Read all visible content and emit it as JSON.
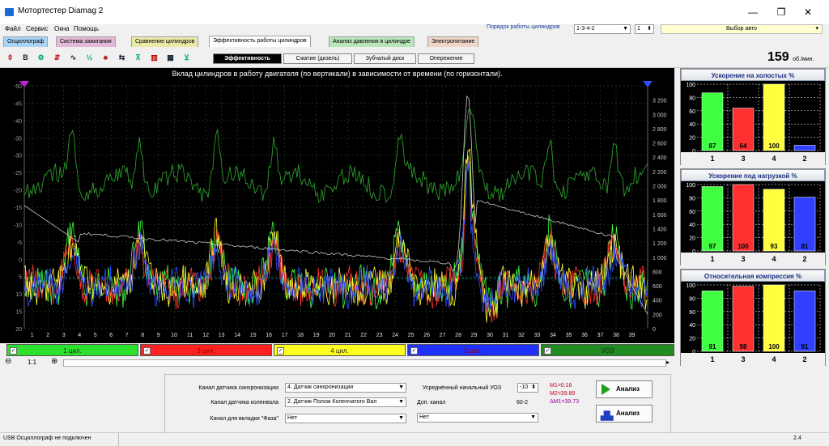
{
  "window": {
    "title": "Мотортестер Diamag 2",
    "minimize": "—",
    "restore": "❐",
    "close": "✕"
  },
  "menu": [
    "Файл",
    "Сервис",
    "Окна",
    "Помощь"
  ],
  "cyl_order": {
    "label": "Порядок работы цилиндров",
    "value": "1-3-4-2",
    "count": "1"
  },
  "vybor": "Выбор авто",
  "tabs": [
    {
      "label": "Осциллограф",
      "color": "#a9d4f5"
    },
    {
      "label": "Система зажигания",
      "color": "#e4b8d8"
    },
    {
      "label": "Сравнение цилиндров",
      "color": "#eaeaa8"
    },
    {
      "label": "Эффективность работы цилиндров",
      "color": "#ffffff"
    },
    {
      "label": "Анализ давления в цилиндре",
      "color": "#b8e6b8"
    },
    {
      "label": "Электропитание",
      "color": "#f0d6c8"
    }
  ],
  "toolbar_icons": [
    "cursor-icon",
    "bold-b-icon",
    "rpm-gear-icon",
    "scale-icon",
    "wave-icon",
    "ratio-icon",
    "tree-icon",
    "sync-icon",
    "filter-icon",
    "chart-icon",
    "table-icon",
    "funnel-icon"
  ],
  "subtabs": [
    "Эффективность",
    "Сжатие (дизель)",
    "Зубчатый диск",
    "Опережение"
  ],
  "rpm": {
    "value": "159",
    "unit": "об./мин."
  },
  "chart": {
    "title": "Вклад цилиндров в работу двигателя (по вертикали) в зависимости от времени (по горизонтали).",
    "left_ticks": [
      "-50",
      "-45",
      "-40",
      "-35",
      "-30",
      "-25",
      "-20",
      "-15",
      "-10",
      "-5",
      "0",
      "5",
      "10",
      "15",
      "20"
    ],
    "right_ticks": [
      "3 200",
      "3 000",
      "2 800",
      "2 600",
      "2 400",
      "2 200",
      "2 000",
      "1 800",
      "1 600",
      "1 400",
      "1 200",
      "1 000",
      "800",
      "600",
      "400",
      "200",
      "0"
    ],
    "x_ticks": [
      "1",
      "2",
      "3",
      "4",
      "5",
      "6",
      "7",
      "8",
      "9",
      "10",
      "11",
      "12",
      "13",
      "14",
      "15",
      "16",
      "17",
      "18",
      "19",
      "20",
      "21",
      "22",
      "23",
      "24",
      "25",
      "26",
      "27",
      "28",
      "29",
      "30",
      "31",
      "32",
      "33",
      "34",
      "35",
      "36",
      "37",
      "38",
      "39"
    ],
    "colors": {
      "c1": "#40ff40",
      "c3": "#ff3030",
      "c4": "#ffff30",
      "c2": "#3050ff",
      "uoz": "#2c9a2c",
      "rpm": "#c8c8c8"
    }
  },
  "legend": [
    {
      "label": "1 цил.",
      "color": "#2ee02e"
    },
    {
      "label": "3 цил.",
      "color": "#ff2020"
    },
    {
      "label": "4 цил.",
      "color": "#ffff20"
    },
    {
      "label": "2 цил.",
      "color": "#2030ff"
    },
    {
      "label": "УОЗ",
      "color": "#1e8c1e"
    }
  ],
  "zoom": {
    "minus": "⊖",
    "value": "1:1",
    "plus": "⊕"
  },
  "panels": [
    {
      "title": "Ускорение на холостых %",
      "values": [
        87,
        64,
        100,
        8
      ],
      "labels": [
        "87",
        "64",
        "100",
        ""
      ]
    },
    {
      "title": "Ускорение под нагрузкой %",
      "values": [
        97,
        100,
        93,
        81
      ],
      "labels": [
        "97",
        "100",
        "93",
        "81"
      ]
    },
    {
      "title": "Относительная компрессия %",
      "values": [
        91,
        98,
        100,
        91
      ],
      "labels": [
        "91",
        "98",
        "100",
        "91"
      ]
    }
  ],
  "panel_cyls": [
    "1",
    "3",
    "4",
    "2"
  ],
  "panel_colors": [
    "#40ff40",
    "#ff3030",
    "#ffff40",
    "#3040ff"
  ],
  "panel_ticks": [
    "100",
    "80",
    "60",
    "40",
    "20",
    "0"
  ],
  "controls": {
    "sync_label": "Канал датчика синхронизации",
    "sync_value": "4. Датчик синхронизации",
    "crank_label": "Канал датчика коленвала",
    "crank_value": "2. Датчик Полож Коленчатого Вал",
    "phase_label": "Канал для вкладки \"Фаза\"",
    "phase_value": "Нет",
    "uoz_label": "Усреднённый начальный УОЗ",
    "uoz_value": "-10",
    "dop_label": "Доп. канал",
    "dop_value": "Нет",
    "teeth": "60-2",
    "m1": "M1=0.16",
    "m2": "M2=39.89",
    "dm": "ΔM1=39.73",
    "analyze1": "Анализ",
    "analyze2": "Анализ"
  },
  "status": {
    "text": "USB Осциллограф не подключен",
    "version": "2.4"
  }
}
